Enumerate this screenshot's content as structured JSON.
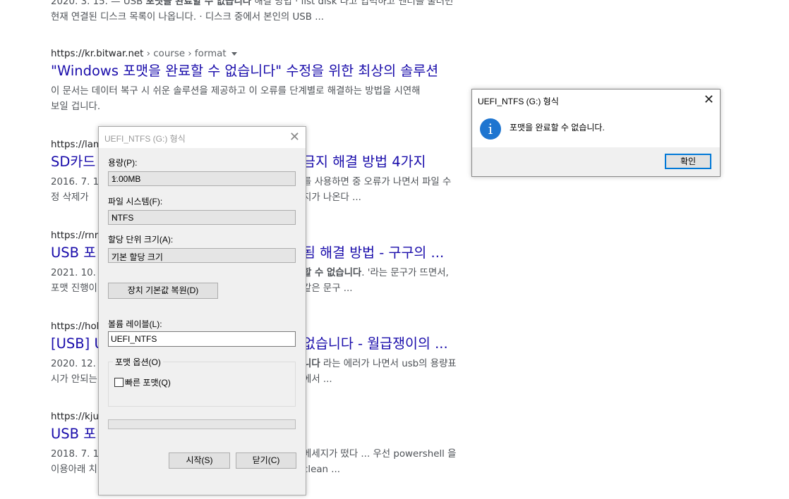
{
  "results": {
    "top_snippet": {
      "line1_a": "2020. 3. 15. — USB ",
      "line1_bold": "포맷을 완료할 수 없습니다",
      "line1_b": " 해결 방법 · list disk 라고 입력하고 엔터를 눌러면",
      "line2": "현재 연결된 디스크 목록이 나옵니다. · 디스크 중에서 본인의 USB ..."
    },
    "items": [
      {
        "cite_host": "https://kr.bitwar.net",
        "cite_path": " › course › format",
        "title": "\"Windows 포맷을 완료할 수 없습니다\" 수정을 위한 최상의 솔루션",
        "desc1": "이 문서는 데이터 복구 시 쉬운 솔루션을 제공하고 이 오류를 단계별로 해결하는 방법을 시연해",
        "desc2": "보일 겁니다."
      },
      {
        "cite_host": "https://lamy",
        "title": "SD카드",
        "title_tail": "금지 해결 방법 4가지",
        "desc1_a": "2016. 7. 12",
        "desc1_b": "를 사용하면 중 오류가 나면서 파일 수",
        "desc2_a": "정 삭제가",
        "desc2_b": "지가 나온다 ..."
      },
      {
        "cite_host": "https://rnrn",
        "title": "USB 포",
        "title_tail": "됨 해결 방법 - 구구의 ...",
        "desc1_a": "2021. 10. 1",
        "desc1_bold": "할 수 없습니다",
        "desc1_b": ". '라는 문구가 뜨면서,",
        "desc2_a": "포맷 진행이",
        "desc2_b": "같은 문구 ..."
      },
      {
        "cite_host": "https://hobl",
        "title": "[USB] U",
        "title_tail": "없습니다 - 월급쟁이의 ...",
        "desc1_a": "2020. 12. 1",
        "desc1_bold": "니다",
        "desc1_b": " 라는 에러가 나면서 usb의 용량표",
        "desc2_a": "시가 안되는",
        "desc2_b": "에서 ..."
      },
      {
        "cite_host": "https://kjun",
        "title": "USB 포",
        "desc1_a": "2018. 7. 16",
        "desc1_b": "메세지가 떴다 ... 우선 powershell 을",
        "desc2_a": "이용아래 치",
        "desc2_b": "clean ..."
      }
    ]
  },
  "format_dialog": {
    "title": "UEFI_NTFS (G:) 형식",
    "capacity_label": "용량(P):",
    "capacity_value": "1.00MB",
    "fs_label": "파일 시스템(F):",
    "fs_value": "NTFS",
    "alloc_label": "할당 단위 크기(A):",
    "alloc_value": "기본 할당 크기",
    "restore_button": "장치 기본값 복원(D)",
    "volume_label": "볼륨 레이블(L):",
    "volume_value": "UEFI_NTFS",
    "options_legend": "포맷 옵션(O)",
    "quick_format_label": "빠른 포맷(Q)",
    "start_button": "시작(S)",
    "close_button": "닫기(C)",
    "progress_fraction": 0
  },
  "message_box": {
    "title": "UEFI_NTFS (G:) 형식",
    "text": "포맷을 완료할 수 없습니다.",
    "ok_button": "확인",
    "icon": "info-icon",
    "icon_glyph": "i"
  },
  "icons": {
    "close_glyph": "✕",
    "chevron_glyph": "⌵"
  }
}
